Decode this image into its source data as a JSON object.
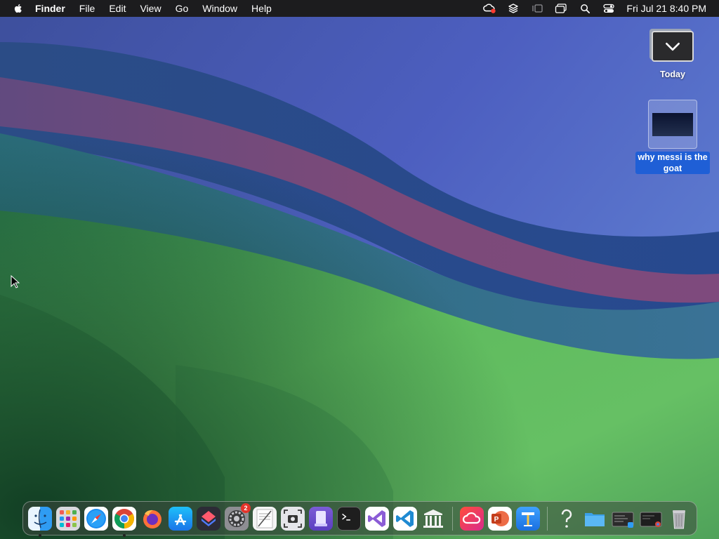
{
  "menubar": {
    "app_name": "Finder",
    "menus": [
      "File",
      "Edit",
      "View",
      "Go",
      "Window",
      "Help"
    ],
    "clock": "Fri Jul 21  8:40 PM",
    "status_icons": [
      "creative-cloud-icon",
      "layers-icon",
      "stage-manager-icon",
      "screen-mirror-icon",
      "spotlight-search-icon",
      "control-center-icon"
    ]
  },
  "desktop": {
    "icons": [
      {
        "name": "today-folder",
        "label": "Today",
        "icon": "stack-icon"
      },
      {
        "name": "document",
        "label": "why messi is the goat",
        "icon": "presentation-document-icon",
        "selected": true
      }
    ]
  },
  "dock": {
    "apps": [
      {
        "name": "finder",
        "icon": "finder-icon",
        "running": true
      },
      {
        "name": "launchpad",
        "icon": "launchpad-icon"
      },
      {
        "name": "safari",
        "icon": "safari-icon"
      },
      {
        "name": "chrome",
        "icon": "chrome-icon",
        "running": true
      },
      {
        "name": "firefox",
        "icon": "firefox-icon"
      },
      {
        "name": "app-store",
        "icon": "app-store-icon"
      },
      {
        "name": "shortcuts",
        "icon": "shortcuts-icon"
      },
      {
        "name": "system-settings",
        "icon": "settings-gear-icon",
        "badge": "2"
      },
      {
        "name": "textedit",
        "icon": "textedit-icon"
      },
      {
        "name": "screenshot",
        "icon": "screenshot-icon"
      },
      {
        "name": "simulator",
        "icon": "simulator-icon"
      },
      {
        "name": "terminal",
        "icon": "terminal-icon"
      },
      {
        "name": "visual-studio",
        "icon": "visual-studio-icon"
      },
      {
        "name": "vscode",
        "icon": "vscode-icon"
      },
      {
        "name": "library",
        "icon": "library-icon"
      }
    ],
    "apps2": [
      {
        "name": "creative-cloud",
        "icon": "creative-cloud-icon"
      },
      {
        "name": "powerpoint",
        "icon": "powerpoint-icon"
      },
      {
        "name": "keynote",
        "icon": "keynote-icon"
      }
    ],
    "apps3": [
      {
        "name": "help",
        "icon": "question-mark-icon"
      },
      {
        "name": "downloads-folder",
        "icon": "folder-icon"
      },
      {
        "name": "recent-window-1",
        "icon": "window-thumbnail-icon"
      },
      {
        "name": "recent-window-2",
        "icon": "window-thumbnail-icon"
      },
      {
        "name": "trash",
        "icon": "trash-icon"
      }
    ],
    "settings_badge": "2"
  },
  "colors": {
    "menubar_bg": "#1c1c1e",
    "selection": "#1f5fd6",
    "badge": "#e5342b"
  }
}
